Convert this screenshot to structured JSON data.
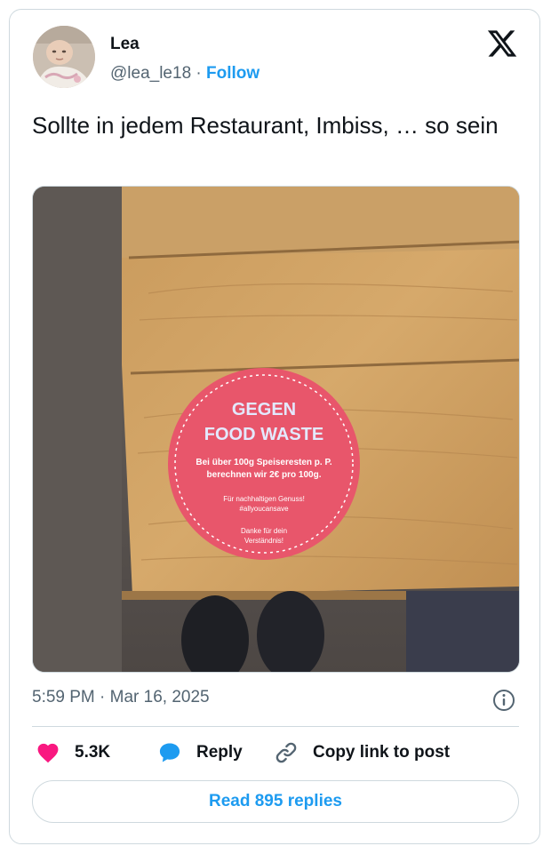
{
  "author": {
    "name": "Lea",
    "handle": "@lea_le18",
    "separator": "·",
    "follow_label": "Follow",
    "avatar_icon": "baby-photo-avatar"
  },
  "platform_icon": "x-logo-icon",
  "tweet": {
    "text": "Sollte in jedem Restaurant, Imbiss, … so sein"
  },
  "photo": {
    "sticker": {
      "headline_1": "GEGEN",
      "headline_2": "FOOD WASTE",
      "line_1": "Bei über 100g Speiseresten p. P.",
      "line_2": "berechnen wir 2€ pro 100g.",
      "line_3": "Für nachhaltigen Genuss!",
      "line_4": "#allyoucansave",
      "line_5": "Danke für dein",
      "line_6": "Verständnis!",
      "color": "#e8566b"
    }
  },
  "timestamp": {
    "time": "5:59 PM",
    "separator": "·",
    "date": "Mar 16, 2025"
  },
  "actions": {
    "likes": "5.3K",
    "reply": "Reply",
    "copy_link": "Copy link to post"
  },
  "read_replies": "Read 895 replies",
  "colors": {
    "accent": "#1d9bf0",
    "heart": "#f91880",
    "text": "#0f1419",
    "muted": "#536471",
    "border": "#cfd9de"
  }
}
